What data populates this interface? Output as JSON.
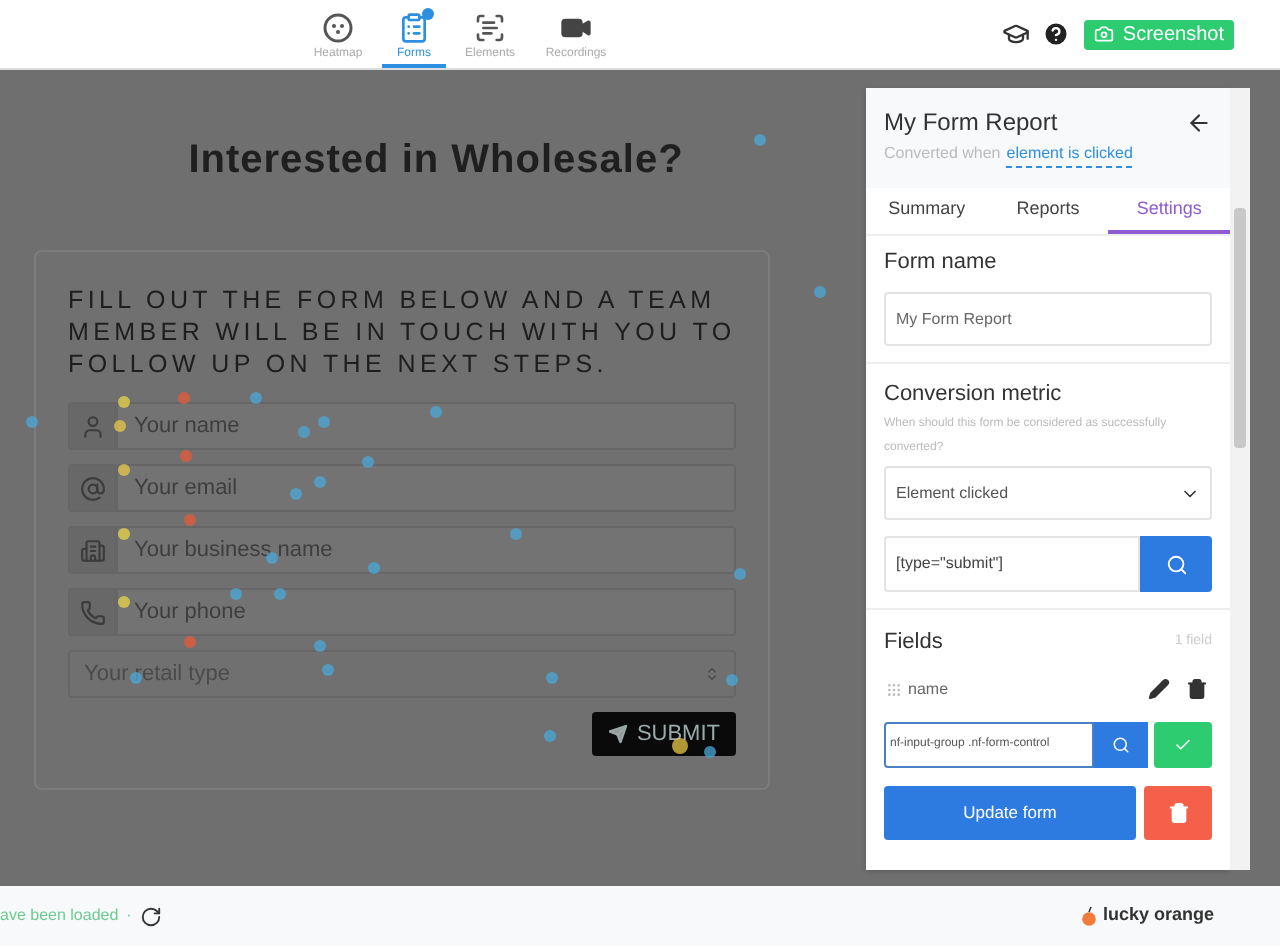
{
  "toolbar": {
    "tabs": [
      {
        "kind": "heatmap",
        "label": "Heatmap",
        "selected": false,
        "badge": false
      },
      {
        "kind": "forms",
        "label": "Forms",
        "selected": true,
        "badge": true
      },
      {
        "kind": "elements",
        "label": "Elements",
        "selected": false,
        "badge": false
      },
      {
        "kind": "recordings",
        "label": "Recordings",
        "selected": false,
        "badge": false
      }
    ],
    "screenshot_button": "Screenshot"
  },
  "page": {
    "title": "Interested in Wholesale?",
    "intro": "FILL OUT THE FORM BELOW AND A TEAM MEMBER WILL BE IN TOUCH WITH YOU TO FOLLOW UP ON THE NEXT STEPS.",
    "fields": [
      {
        "kind": "person",
        "placeholder": "Your name"
      },
      {
        "kind": "email",
        "placeholder": "Your email"
      },
      {
        "kind": "building",
        "placeholder": "Your business name"
      },
      {
        "kind": "phone",
        "placeholder": "Your phone"
      }
    ],
    "select": "Your retail type",
    "submit": "SUBMIT"
  },
  "panel": {
    "title": "My Form Report",
    "subtitle": "Converted when",
    "subtitle_link": "element is clicked",
    "tabs": [
      {
        "label": "Summary",
        "selected": false
      },
      {
        "label": "Reports",
        "selected": false
      },
      {
        "label": "Settings",
        "selected": true
      }
    ],
    "form_name": {
      "label": "Form name",
      "value": "My Form Report"
    },
    "conversion": {
      "label": "Conversion metric",
      "help": "When should this form be considered as successfully converted?",
      "select": "Element clicked",
      "selector": "[type=\"submit\"]"
    },
    "fields": {
      "label": "Fields",
      "count": "1 field",
      "items": [
        {
          "name": "name"
        }
      ],
      "selector": "nf-input-group .nf-form-control"
    },
    "update_button": "Update form"
  },
  "status": {
    "message": "ave been loaded",
    "separator": "·",
    "brand": "lucky orange"
  }
}
